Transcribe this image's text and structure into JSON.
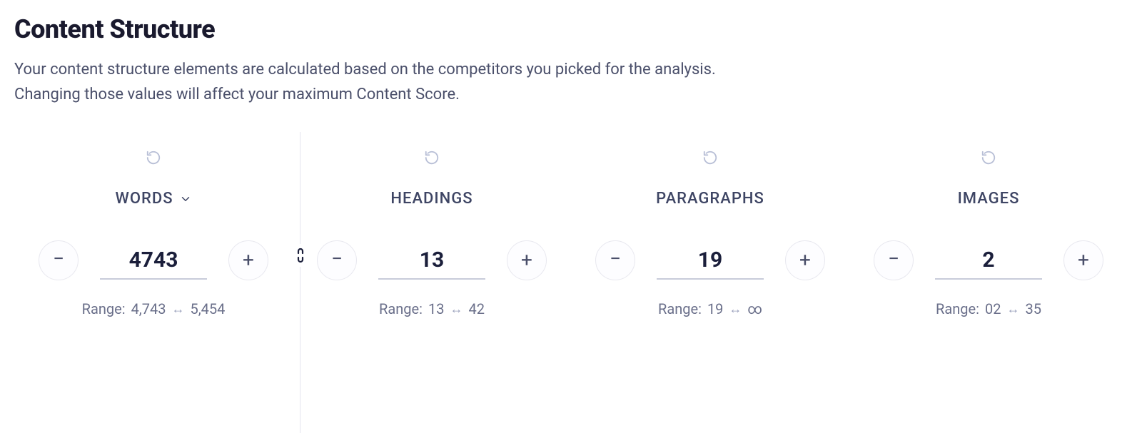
{
  "header": {
    "title": "Content Structure",
    "description_line1": "Your content structure elements are calculated based on the competitors you picked for the analysis.",
    "description_line2": "Changing those values will affect your maximum Content Score."
  },
  "metrics": {
    "words": {
      "label": "WORDS",
      "value": "4743",
      "range_prefix": "Range:",
      "range_low": "4,743",
      "range_high": "5,454",
      "has_dropdown": true
    },
    "headings": {
      "label": "HEADINGS",
      "value": "13",
      "range_prefix": "Range:",
      "range_low": "13",
      "range_high": "42",
      "has_dropdown": false
    },
    "paragraphs": {
      "label": "PARAGRAPHS",
      "value": "19",
      "range_prefix": "Range:",
      "range_low": "19",
      "range_high": "∞",
      "has_dropdown": false
    },
    "images": {
      "label": "IMAGES",
      "value": "2",
      "range_prefix": "Range:",
      "range_low": "02",
      "range_high": "35",
      "has_dropdown": false
    }
  }
}
